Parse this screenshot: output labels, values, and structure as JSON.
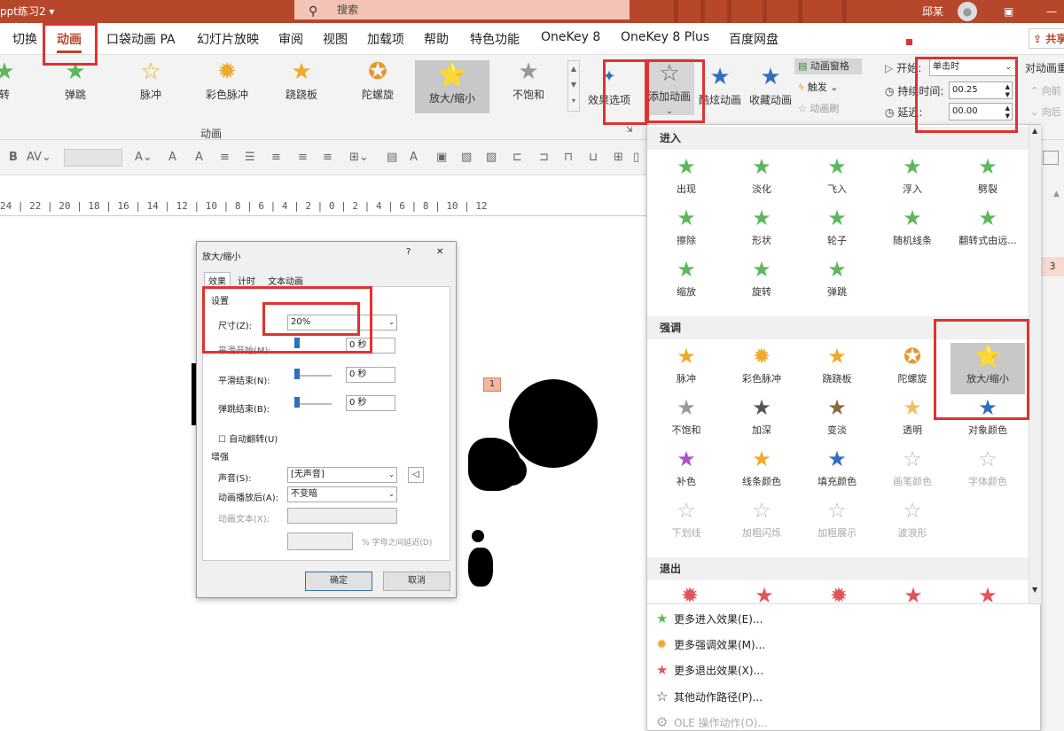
{
  "titlebar": {
    "doc_title": "ppt练习2 ▾",
    "search": "搜索",
    "user": "邱某"
  },
  "tabs": [
    "切换",
    "动画",
    "口袋动画 PA",
    "幻灯片放映",
    "审阅",
    "视图",
    "加载项",
    "帮助",
    "特色功能",
    "OneKey 8",
    "OneKey 8 Plus",
    "百度网盘"
  ],
  "share_label": "共享",
  "gallery": [
    {
      "label": "转",
      "icon": "★"
    },
    {
      "label": "弹跳",
      "icon": "★"
    },
    {
      "label": "脉冲",
      "icon": "☆"
    },
    {
      "label": "彩色脉冲",
      "icon": "✹"
    },
    {
      "label": "跷跷板",
      "icon": "★"
    },
    {
      "label": "陀螺旋",
      "icon": "✪"
    },
    {
      "label": "放大/缩小",
      "icon": "⭐"
    },
    {
      "label": "不饱和",
      "icon": "★"
    }
  ],
  "effect_options": "效果选项",
  "add_animation": "添加动画",
  "fancy_animation": "酷炫动画",
  "fav_animation": "收藏动画",
  "anim_pane": "动画窗格",
  "trigger": "触发",
  "anim_brush": "动画刷",
  "group_label": "动画",
  "timing": {
    "start_label": "开始:",
    "start_value": "单击时",
    "duration_label": "持续时间:",
    "duration_value": "00.25",
    "delay_label": "延迟:",
    "delay_value": "00.00"
  },
  "reorder": {
    "title": "对动画重",
    "forward": "向前",
    "backward": "向后"
  },
  "ruler_text": "24 | 22 | 20 | 18 | 16 | 14 | 12 | 10 | 8 | 6 | 4 | 2 | 0 | 2 | 4 | 6 | 8 | 10 | 12",
  "slide_tag": "1",
  "side_number": "3",
  "dialog": {
    "title": "放大/缩小",
    "help": "?",
    "close": "✕",
    "tabs": [
      "效果",
      "计时",
      "文本动画"
    ],
    "settings": "设置",
    "size_label": "尺寸(Z):",
    "size_value": "20%",
    "smooth_start_label": "平滑开始(M):",
    "smooth_start_value": "0 秒",
    "smooth_end_label": "平滑结束(N):",
    "smooth_end_value": "0 秒",
    "bounce_end_label": "弹跳结束(B):",
    "bounce_end_value": "0 秒",
    "auto_reverse": "自动翻转(U)",
    "enhance": "增强",
    "sound_label": "声音(S):",
    "sound_value": "[无声音]",
    "after_label": "动画播放后(A):",
    "after_value": "不变暗",
    "text_label": "动画文本(X):",
    "letter_delay": "% 字母之间延迟(D)",
    "ok": "确定",
    "cancel": "取消"
  },
  "panel": {
    "entrance_title": "进入",
    "entrance": [
      {
        "label": "出现",
        "icon": "★"
      },
      {
        "label": "淡化",
        "icon": "★"
      },
      {
        "label": "飞入",
        "icon": "★"
      },
      {
        "label": "浮入",
        "icon": "★"
      },
      {
        "label": "劈裂",
        "icon": "★"
      },
      {
        "label": "擦除",
        "icon": "★"
      },
      {
        "label": "形状",
        "icon": "★"
      },
      {
        "label": "轮子",
        "icon": "★"
      },
      {
        "label": "随机线条",
        "icon": "★"
      },
      {
        "label": "翻转式由远...",
        "icon": "★"
      },
      {
        "label": "缩放",
        "icon": "★"
      },
      {
        "label": "旋转",
        "icon": "★"
      },
      {
        "label": "弹跳",
        "icon": "★"
      }
    ],
    "emphasis_title": "强调",
    "emphasis": [
      {
        "label": "脉冲",
        "icon": "★"
      },
      {
        "label": "彩色脉冲",
        "icon": "✹"
      },
      {
        "label": "跷跷板",
        "icon": "★"
      },
      {
        "label": "陀螺旋",
        "icon": "✪"
      },
      {
        "label": "放大/缩小",
        "icon": "⭐"
      },
      {
        "label": "不饱和",
        "icon": "★"
      },
      {
        "label": "加深",
        "icon": "★"
      },
      {
        "label": "变淡",
        "icon": "★"
      },
      {
        "label": "透明",
        "icon": "★"
      },
      {
        "label": "对象颜色",
        "icon": "★"
      },
      {
        "label": "补色",
        "icon": "★"
      },
      {
        "label": "线条颜色",
        "icon": "★"
      },
      {
        "label": "填充颜色",
        "icon": "★"
      },
      {
        "label": "画笔颜色",
        "icon": "☆"
      },
      {
        "label": "字体颜色",
        "icon": "☆"
      },
      {
        "label": "下划线",
        "icon": "☆"
      },
      {
        "label": "加粗闪烁",
        "icon": "☆"
      },
      {
        "label": "加粗展示",
        "icon": "☆"
      },
      {
        "label": "波浪形",
        "icon": "☆"
      }
    ],
    "exit_title": "退出",
    "more": [
      {
        "label": "更多进入效果(E)...",
        "icon": "★"
      },
      {
        "label": "更多强调效果(M)...",
        "icon": "✹"
      },
      {
        "label": "更多退出效果(X)...",
        "icon": "★"
      },
      {
        "label": "其他动作路径(P)...",
        "icon": "☆"
      },
      {
        "label": "OLE 操作动作(O)...",
        "icon": "⚙"
      }
    ]
  }
}
